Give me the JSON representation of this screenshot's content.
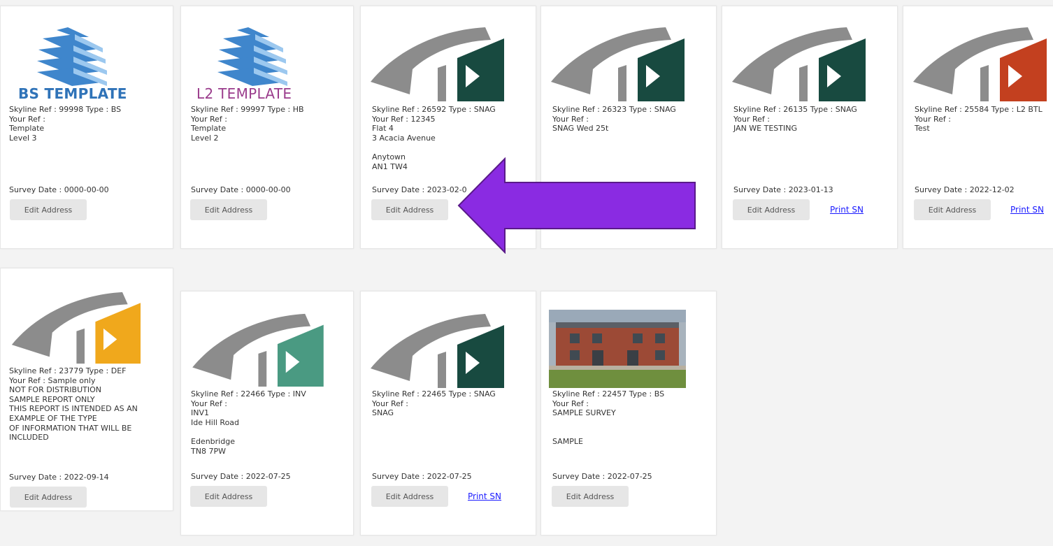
{
  "colors": {
    "page_bg": "#f3f3f3",
    "card_bg": "#ffffff",
    "logo_grey": "#8c8c8c",
    "logo_dark_green": "#184a40",
    "logo_orange_red": "#c3401f",
    "logo_yellow": "#f0a81c",
    "logo_teal": "#4a9a82",
    "bs_blue": "#2f73b8",
    "l2_purple": "#9a3c8c",
    "arrow_purple": "#8a2be2",
    "link_blue": "#1a1aff"
  },
  "cards": [
    {
      "logo_icon": "building-blue-icon",
      "logo_label": "BS TEMPLATE",
      "lines": [
        "Skyline Ref : 99998 Type : BS",
        "Your Ref :",
        "Template",
        "Level 3"
      ],
      "survey_date": "Survey Date : 0000-00-00",
      "edit_label": "Edit Address"
    },
    {
      "logo_icon": "building-blue-icon",
      "logo_label": "L2 TEMPLATE",
      "lines": [
        "Skyline Ref : 99997 Type : HB",
        "Your Ref :",
        "Template",
        "Level 2"
      ],
      "survey_date": "Survey Date : 0000-00-00",
      "edit_label": "Edit Address"
    },
    {
      "logo_icon": "skyline-logo-green-icon",
      "lines": [
        "Skyline Ref : 26592 Type : SNAG",
        "Your Ref : 12345",
        "Flat 4",
        "3 Acacia Avenue",
        "",
        "Anytown",
        "AN1 TW4"
      ],
      "survey_date": "Survey Date : 2023-02-0",
      "edit_label": "Edit Address"
    },
    {
      "logo_icon": "skyline-logo-green-icon",
      "lines": [
        "Skyline Ref : 26323 Type : SNAG",
        "Your Ref :",
        "SNAG Wed 25t"
      ],
      "survey_date": "",
      "edit_label": ""
    },
    {
      "logo_icon": "skyline-logo-green-icon",
      "lines": [
        "Skyline Ref : 26135 Type : SNAG",
        "Your Ref :",
        "JAN WE TESTING"
      ],
      "survey_date": "Survey Date : 2023-01-13",
      "edit_label": "Edit Address",
      "print_label": "Print SN"
    },
    {
      "logo_icon": "skyline-logo-red-icon",
      "lines": [
        "Skyline Ref : 25584 Type : L2 BTL",
        "Your Ref :",
        "Test"
      ],
      "survey_date": "Survey Date : 2022-12-02",
      "edit_label": "Edit Address",
      "print_label": "Print SN"
    },
    {
      "logo_icon": "skyline-logo-yellow-icon",
      "lines": [
        "Skyline Ref : 23779 Type : DEF",
        "Your Ref : Sample only",
        "NOT FOR DISTRIBUTION",
        "SAMPLE REPORT ONLY",
        "THIS REPORT IS INTENDED AS AN",
        "EXAMPLE OF THE TYPE",
        "OF INFORMATION THAT WILL BE",
        "INCLUDED"
      ],
      "survey_date": "Survey Date : 2022-09-14",
      "edit_label": "Edit Address"
    },
    {
      "logo_icon": "skyline-logo-teal-icon",
      "lines": [
        "Skyline Ref : 22466 Type : INV",
        "Your Ref :",
        "INV1",
        "Ide Hill Road",
        "",
        "Edenbridge",
        "TN8 7PW"
      ],
      "survey_date": "Survey Date : 2022-07-25",
      "edit_label": "Edit Address"
    },
    {
      "logo_icon": "skyline-logo-green-icon",
      "lines": [
        "Skyline Ref : 22465 Type : SNAG",
        "Your Ref :",
        "SNAG"
      ],
      "survey_date": "Survey Date : 2022-07-25",
      "edit_label": "Edit Address",
      "print_label": "Print SN"
    },
    {
      "logo_icon": "house-photo-icon",
      "lines": [
        "Skyline Ref : 22457 Type : BS",
        "Your Ref :",
        "SAMPLE SURVEY",
        "",
        "",
        "SAMPLE"
      ],
      "survey_date": "Survey Date : 2022-07-25",
      "edit_label": "Edit Address"
    }
  ],
  "annotation": {
    "icon": "left-arrow-icon"
  }
}
